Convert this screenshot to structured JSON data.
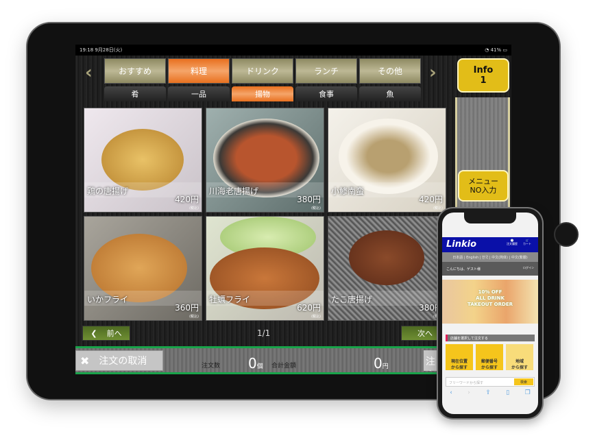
{
  "status": {
    "time": "19:18",
    "date": "9月28日(火)",
    "battery": "41%"
  },
  "categories": [
    {
      "label": "おすすめ"
    },
    {
      "label": "料理",
      "active": true
    },
    {
      "label": "ドリンク"
    },
    {
      "label": "ランチ"
    },
    {
      "label": "その他"
    }
  ],
  "subcategories": [
    {
      "label": "肴"
    },
    {
      "label": "一品"
    },
    {
      "label": "揚物",
      "active": true
    },
    {
      "label": "食事"
    },
    {
      "label": "魚"
    }
  ],
  "items": [
    {
      "name": "鶏の唐揚げ",
      "price": "420円",
      "tax": "(税込)"
    },
    {
      "name": "川海老唐揚げ",
      "price": "380円",
      "tax": "(税込)"
    },
    {
      "name": "小鯵南蛮",
      "price": "420円",
      "tax": "(税込)"
    },
    {
      "name": "いかフライ",
      "price": "360円",
      "tax": "(税込)"
    },
    {
      "name": "牡蠣フライ",
      "price": "620円",
      "tax": "(税込)"
    },
    {
      "name": "たこ唐揚げ",
      "price": "380円",
      "tax": "(税込)"
    }
  ],
  "pager": {
    "prev": "前へ",
    "next": "次へ",
    "page": "1/1"
  },
  "footer": {
    "cancel": "注文の取消",
    "count_label": "注文数",
    "count": "0",
    "count_unit": "個",
    "total_label": "合計金額",
    "total": "0",
    "total_unit": "円",
    "order": "注文"
  },
  "side": {
    "info": "Info",
    "info_count": "1",
    "menu_no": "メニュー",
    "menu_no2": "NO入力"
  },
  "phone": {
    "logo": "Linkio",
    "history": "注文履歴",
    "cart": "カート",
    "langs": "日本語 | English | 한국 | 中文(简体) | 中文(繁體)",
    "greeting": "こんにちは、ゲスト様",
    "login": "ログイン",
    "banner1": "10% OFF",
    "banner2": "ALL DRINK",
    "banner3": "TAKEOUT ORDER",
    "section": "店舗を選択して注文する",
    "btn1": "現在位置",
    "btn2": "郵便番号",
    "btn3": "地域",
    "btn_sub": "から探す",
    "search_placeholder": "フリーワードから探す",
    "search_btn": "検索"
  },
  "colors": {
    "accent": "#e8701f",
    "gold": "#e2bd18",
    "green": "#19a34a",
    "brand": "#0a10a8"
  }
}
